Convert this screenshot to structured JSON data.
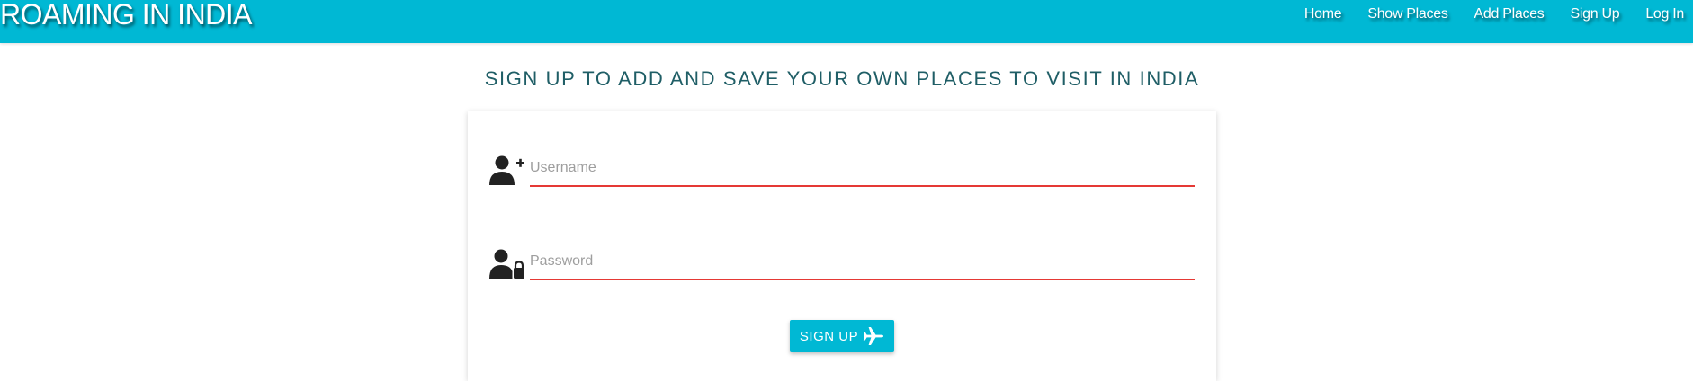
{
  "navbar": {
    "brand": "ROAMING IN INDIA",
    "links": [
      "Home",
      "Show Places",
      "Add Places",
      "Sign Up",
      "Log In"
    ],
    "background_color": "#00b8d4"
  },
  "main": {
    "heading": "SIGN UP TO ADD AND SAVE YOUR OWN PLACES TO VISIT IN INDIA",
    "heading_color": "#1f5e66"
  },
  "form": {
    "username": {
      "icon": "user-plus-icon",
      "placeholder": "Username",
      "value": ""
    },
    "password": {
      "icon": "user-lock-icon",
      "placeholder": "Password",
      "value": ""
    },
    "submit": {
      "label": "SIGN UP",
      "icon": "plane-icon"
    },
    "underline_color": "#e53935"
  }
}
